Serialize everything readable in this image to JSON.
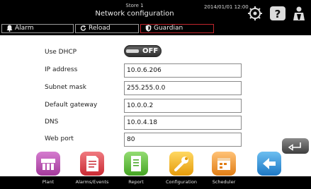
{
  "header": {
    "store": "Store 1",
    "title": "Network configuration",
    "datetime": "2014/01/01  12:00",
    "buttons": {
      "alarm": "Alarm",
      "reload": "Reload",
      "guardian": "Guardian"
    }
  },
  "dhcp": {
    "label": "Use DHCP",
    "value": "OFF"
  },
  "fields": [
    {
      "label": "IP address",
      "value": "10.0.6.206"
    },
    {
      "label": "Subnet mask",
      "value": "255.255.0.0"
    },
    {
      "label": "Default gateway",
      "value": "10.0.0.2"
    },
    {
      "label": "DNS",
      "value": "10.0.4.18"
    },
    {
      "label": "Web port",
      "value": "80"
    }
  ],
  "nav": [
    {
      "label": "Plant",
      "icon": "plant-icon",
      "color": "#b84bb0"
    },
    {
      "label": "Alarms/Events",
      "icon": "alarms-events-icon",
      "color": "#e2434b"
    },
    {
      "label": "Report",
      "icon": "report-icon",
      "color": "#5fbf3a"
    },
    {
      "label": "Configuration",
      "icon": "configuration-icon",
      "color": "#f2b51f"
    },
    {
      "label": "Scheduler",
      "icon": "scheduler-icon",
      "color": "#f39a2a"
    },
    {
      "label": "",
      "icon": "back-arrow-icon",
      "color": "#2c8fd6"
    }
  ],
  "colors": {
    "guardian_border": "#c0262d",
    "body_bg": "#ffffff",
    "chrome_bg": "#000000"
  }
}
